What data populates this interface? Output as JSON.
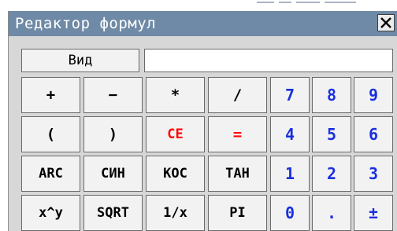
{
  "window": {
    "title": "Редактор формул",
    "close_icon": "close-icon"
  },
  "view_button": {
    "label": "Вид"
  },
  "formula_input": {
    "value": ""
  },
  "operators": {
    "row1": [
      "+",
      "−",
      "*",
      "/"
    ],
    "row2": [
      "(",
      ")",
      "CE",
      "="
    ],
    "row3": [
      "ARC",
      "СИН",
      "КОС",
      "ТАН"
    ],
    "row4": [
      "x^y",
      "SQRT",
      "1/x",
      "PI"
    ]
  },
  "keypad": {
    "row1": [
      "7",
      "8",
      "9"
    ],
    "row2": [
      "4",
      "5",
      "6"
    ],
    "row3": [
      "1",
      "2",
      "3"
    ],
    "row4": [
      "0",
      ".",
      "±"
    ]
  },
  "colors": {
    "titlebar": "#6f8aa6",
    "background": "#d7d7d7",
    "button_face": "#f2f2f2",
    "digit_text": "#1a2fe0",
    "clear_text": "#ff0000"
  }
}
